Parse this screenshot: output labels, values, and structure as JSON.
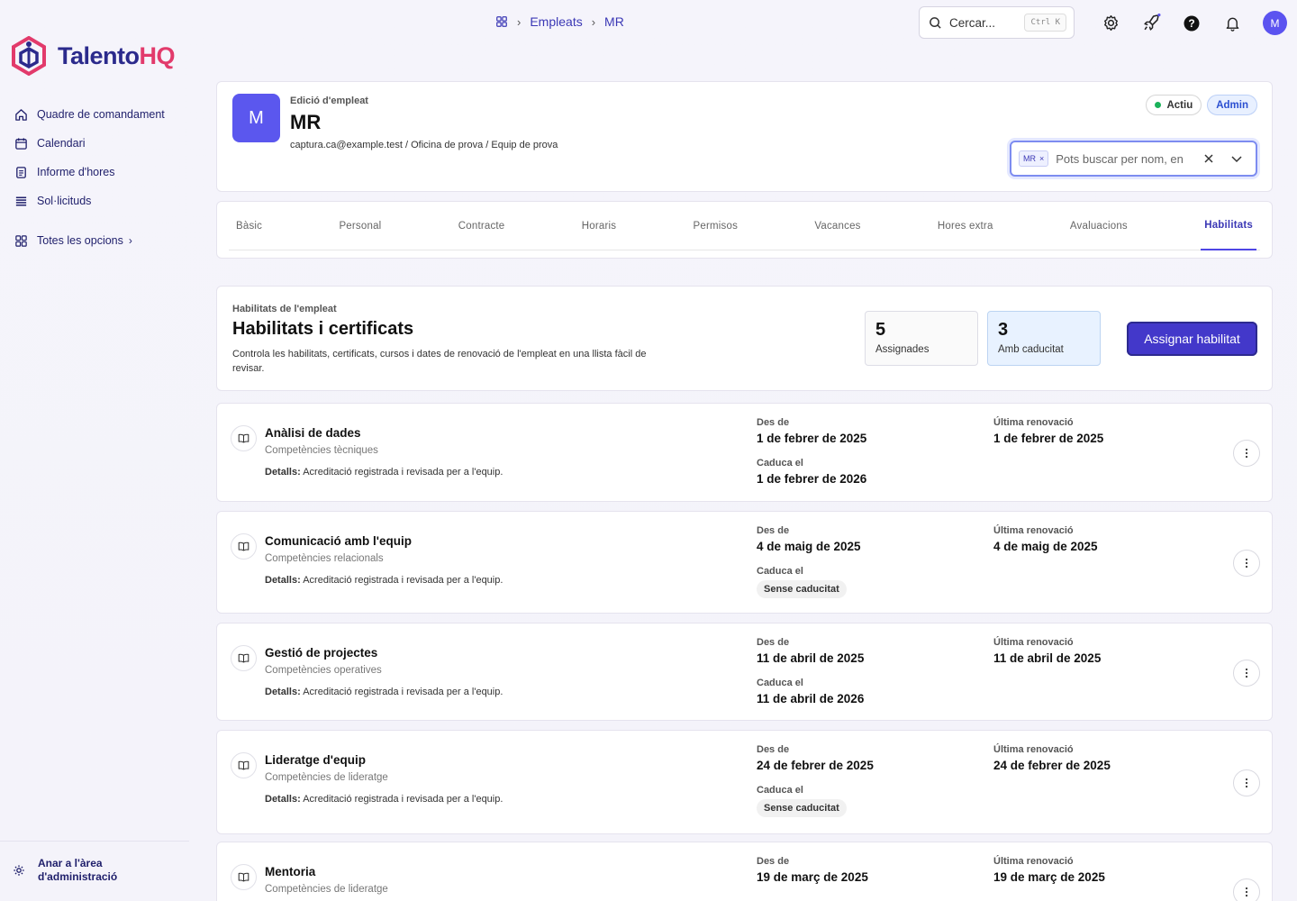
{
  "brand": {
    "name_part1": "Talento",
    "name_part2": "HQ"
  },
  "nav": {
    "items": [
      {
        "label": "Quadre de comandament",
        "icon": "home-icon"
      },
      {
        "label": "Calendari",
        "icon": "calendar-icon"
      },
      {
        "label": "Informe d'hores",
        "icon": "report-icon"
      },
      {
        "label": "Sol·licituds",
        "icon": "list-icon"
      }
    ],
    "all_options": "Totes les opcions",
    "admin_link": "Anar a l'àrea d'administració"
  },
  "breadcrumb": {
    "section": "Empleats",
    "current": "MR"
  },
  "search": {
    "placeholder": "Cercar...",
    "shortcut": "Ctrl K"
  },
  "user": {
    "initial": "M"
  },
  "employee": {
    "overline": "Edició d'empleat",
    "initials": "MR",
    "avatar_initial": "M",
    "email": "captura.ca@example.test",
    "office": "Oficina de prova",
    "team": "Equip de prova",
    "status": "Actiu",
    "role": "Admin",
    "selector_chip": "MR",
    "selector_placeholder": "Pots buscar per nom, en"
  },
  "tabs": [
    "Bàsic",
    "Personal",
    "Contracte",
    "Horaris",
    "Permisos",
    "Vacances",
    "Hores extra",
    "Avaluacions",
    "Habilitats"
  ],
  "active_tab": "Habilitats",
  "skills_header": {
    "overline": "Habilitats de l'empleat",
    "title": "Habilitats i certificats",
    "description": "Controla les habilitats, certificats, cursos i dates de renovació de l'empleat en una llista fàcil de revisar.",
    "assigned_count": "5",
    "assigned_label": "Assignades",
    "expiring_count": "3",
    "expiring_label": "Amb caducitat",
    "assign_button": "Assignar habilitat"
  },
  "labels": {
    "from": "Des de",
    "expires": "Caduca el",
    "last_renewal": "Última renovació",
    "details": "Detalls:",
    "no_expiry": "Sense caducitat"
  },
  "skills": [
    {
      "name": "Anàlisi de dades",
      "category": "Competències tècniques",
      "details": "Acreditació registrada i revisada per a l'equip.",
      "from": "1 de febrer de 2025",
      "expires": "1 de febrer de 2026",
      "last_renewal": "1 de febrer de 2025"
    },
    {
      "name": "Comunicació amb l'equip",
      "category": "Competències relacionals",
      "details": "Acreditació registrada i revisada per a l'equip.",
      "from": "4 de maig de 2025",
      "expires": "Sense caducitat",
      "last_renewal": "4 de maig de 2025"
    },
    {
      "name": "Gestió de projectes",
      "category": "Competències operatives",
      "details": "Acreditació registrada i revisada per a l'equip.",
      "from": "11 de abril de 2025",
      "expires": "11 de abril de 2026",
      "last_renewal": "11 de abril de 2025"
    },
    {
      "name": "Lideratge d'equip",
      "category": "Competències de lideratge",
      "details": "Acreditació registrada i revisada per a l'equip.",
      "from": "24 de febrer de 2025",
      "expires": "Sense caducitat",
      "last_renewal": "24 de febrer de 2025"
    },
    {
      "name": "Mentoria",
      "category": "Competències de lideratge",
      "details": "",
      "from": "19 de març de 2025",
      "expires": "",
      "last_renewal": "19 de març de 2025"
    }
  ],
  "colors": {
    "accent": "#4338ca",
    "brand_dark": "#2b2a8c",
    "brand_pink": "#e23a6b",
    "active_green": "#1bb25a"
  }
}
